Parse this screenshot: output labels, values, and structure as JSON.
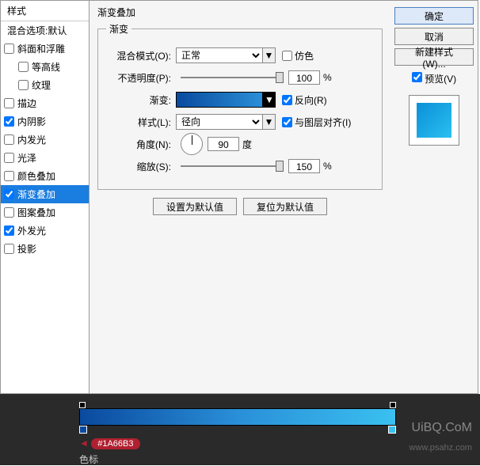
{
  "styles_panel": {
    "header": "样式",
    "items": [
      {
        "label": "混合选项:默认",
        "checked": null,
        "indent": false
      },
      {
        "label": "斜面和浮雕",
        "checked": false,
        "indent": false
      },
      {
        "label": "等高线",
        "checked": false,
        "indent": true
      },
      {
        "label": "纹理",
        "checked": false,
        "indent": true
      },
      {
        "label": "描边",
        "checked": false,
        "indent": false
      },
      {
        "label": "内阴影",
        "checked": true,
        "indent": false
      },
      {
        "label": "内发光",
        "checked": false,
        "indent": false
      },
      {
        "label": "光泽",
        "checked": false,
        "indent": false
      },
      {
        "label": "颜色叠加",
        "checked": false,
        "indent": false
      },
      {
        "label": "渐变叠加",
        "checked": true,
        "indent": false,
        "selected": true
      },
      {
        "label": "图案叠加",
        "checked": false,
        "indent": false
      },
      {
        "label": "外发光",
        "checked": true,
        "indent": false
      },
      {
        "label": "投影",
        "checked": false,
        "indent": false
      }
    ]
  },
  "main": {
    "section_title": "渐变叠加",
    "group_title": "渐变",
    "blend_mode": {
      "label": "混合模式(O):",
      "value": "正常"
    },
    "dither": {
      "label": "仿色",
      "checked": false
    },
    "opacity": {
      "label": "不透明度(P):",
      "value": "100",
      "unit": "%"
    },
    "gradient": {
      "label": "渐变:"
    },
    "reverse": {
      "label": "反向(R)",
      "checked": true
    },
    "style": {
      "label": "样式(L):",
      "value": "径向"
    },
    "align": {
      "label": "与图层对齐(I)",
      "checked": true
    },
    "angle": {
      "label": "角度(N):",
      "value": "90",
      "unit": "度"
    },
    "scale": {
      "label": "缩放(S):",
      "value": "150",
      "unit": "%"
    },
    "set_default": "设置为默认值",
    "reset_default": "复位为默认值"
  },
  "right": {
    "ok": "确定",
    "cancel": "取消",
    "new_style": "新建样式(W)...",
    "preview": {
      "label": "预览(V)",
      "checked": true
    }
  },
  "bottom": {
    "hex": "#1A66B3",
    "stops_label": "色标"
  },
  "watermark1": "UiBQ.CoM",
  "watermark2": "www.psahz.com"
}
